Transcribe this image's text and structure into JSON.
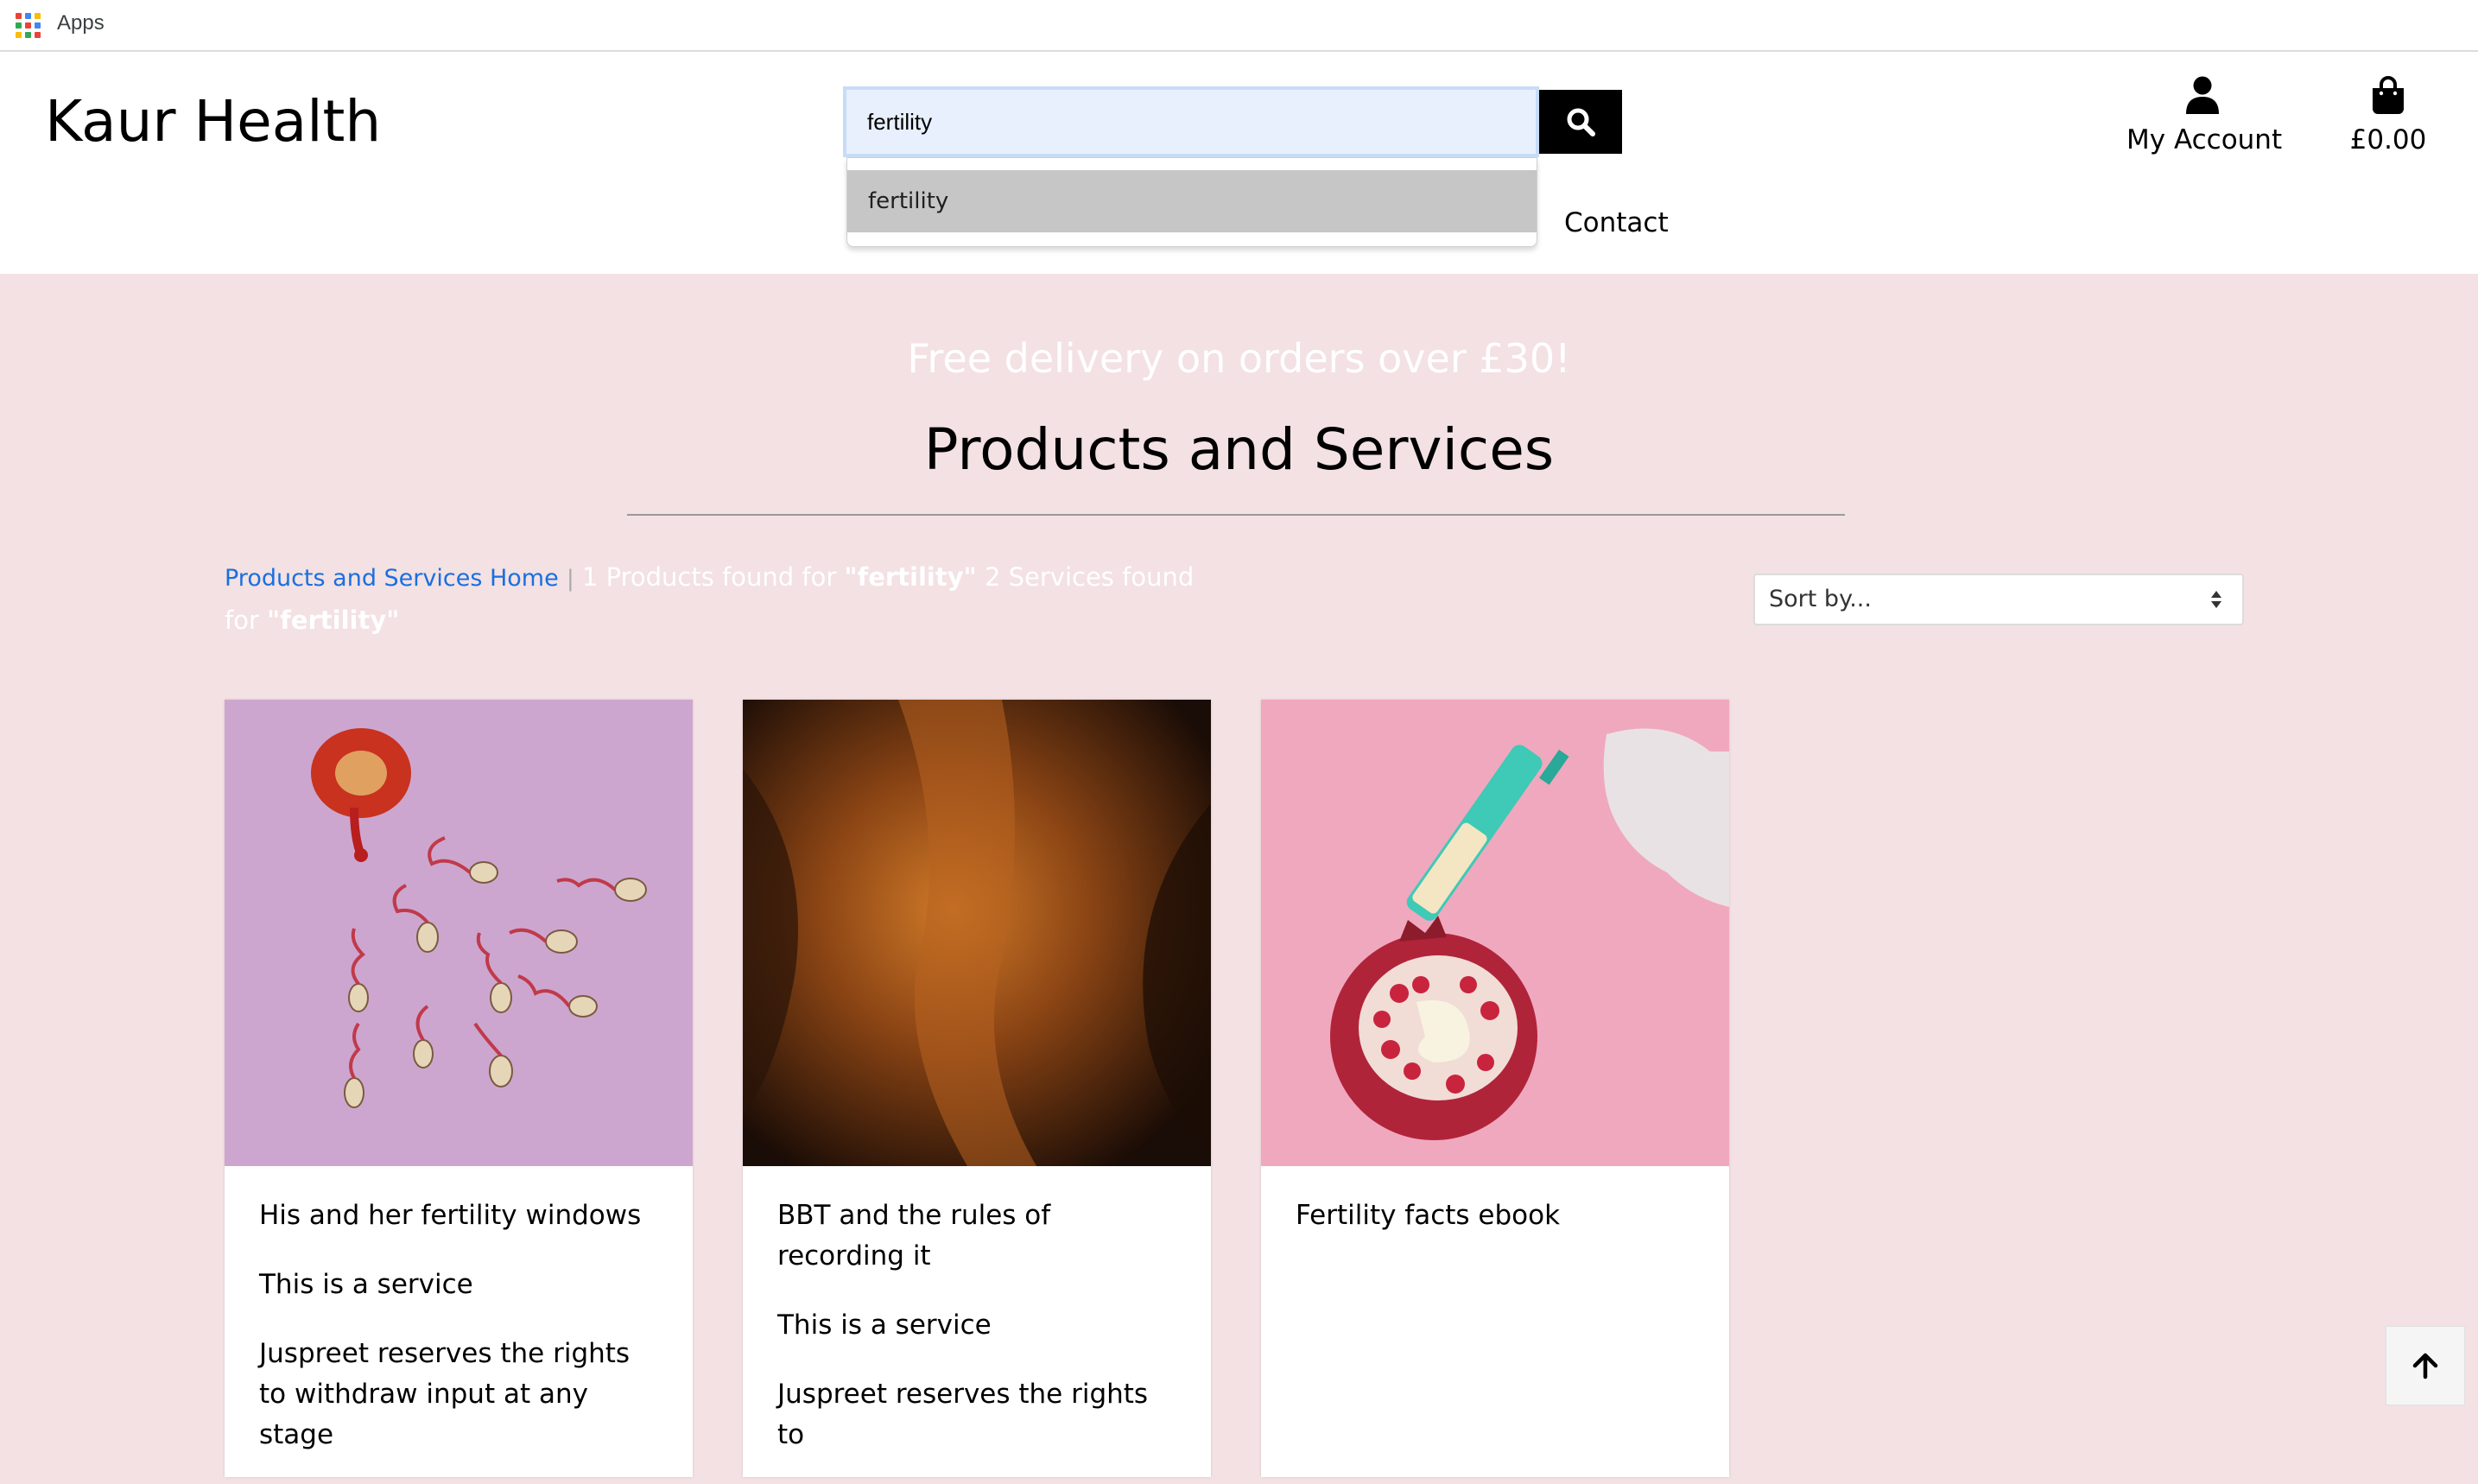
{
  "bookmarks": {
    "apps_label": "Apps"
  },
  "header": {
    "brand": "Kaur Health",
    "search": {
      "value": "fertility",
      "placeholder": ""
    },
    "suggestions": [
      "fertility"
    ],
    "nav_contact": "Contact",
    "account_label": "My Account",
    "cart_total": "£0.00",
    "icons": {
      "search": "search-icon",
      "account": "user-icon",
      "cart": "shopping-bag-icon"
    }
  },
  "main": {
    "delivery_banner": "Free delivery on orders over £30!",
    "title": "Products and Services",
    "breadcrumb_home": "Products and Services Home",
    "breadcrumb_sep": "|",
    "results_count_products": "1 Products found for",
    "results_query_1": "\"fertility\"",
    "results_count_services": "2 Services found for",
    "results_query_2": "\"fertility\"",
    "sort_label": "Sort by...",
    "cards": [
      {
        "title": "His and her fertility windows",
        "type_text": "This is a service",
        "disclaimer": "Juspreet reserves the rights to withdraw input at any stage"
      },
      {
        "title": "BBT and the rules of recording it",
        "type_text": "This is a service",
        "disclaimer": "Juspreet reserves the rights to"
      },
      {
        "title": "Fertility facts ebook"
      }
    ]
  },
  "colors": {
    "page_bg": "#f3e1e3",
    "link": "#1a6fe0",
    "search_btn": "#000000",
    "search_field_bg": "#e8f0fe"
  }
}
